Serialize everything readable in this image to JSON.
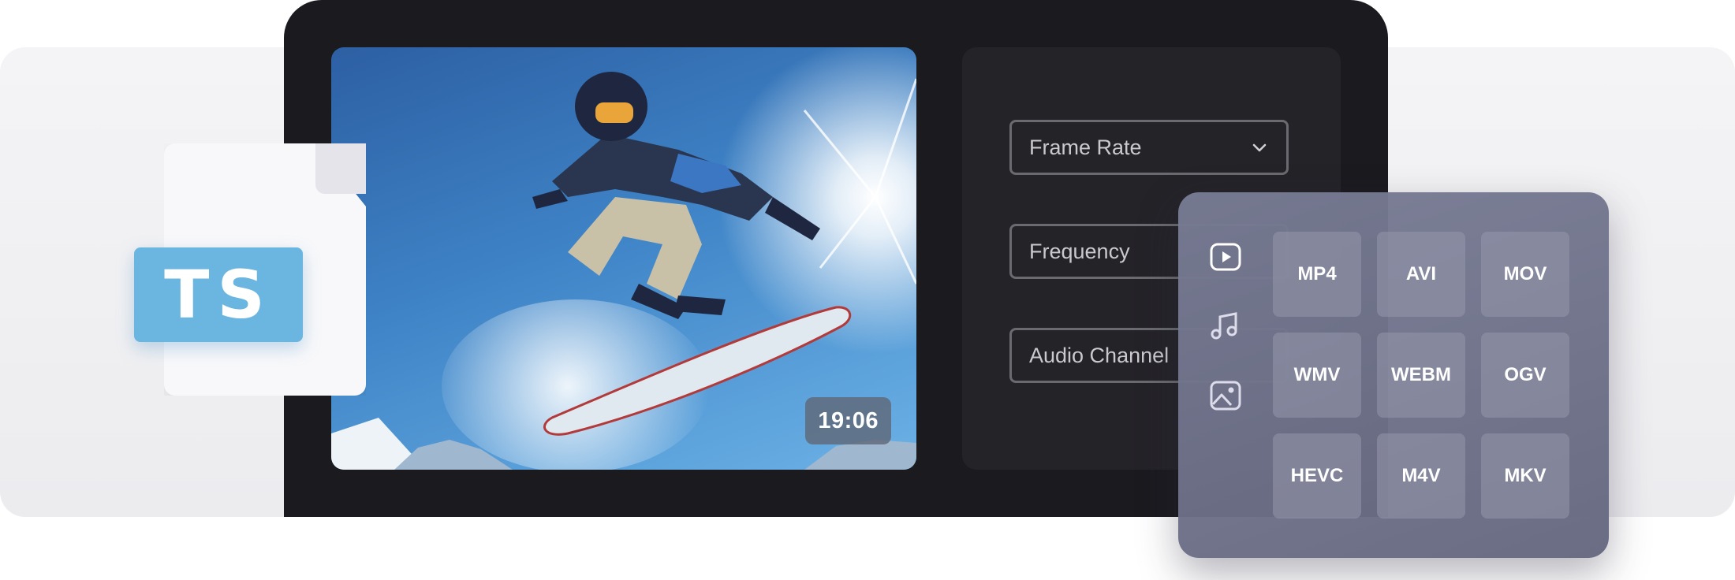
{
  "file_badge": {
    "extension": "TS"
  },
  "video": {
    "duration": "19:06",
    "thumbnail_subject": "snowboarder-jump-image"
  },
  "settings": {
    "frame_rate_label": "Frame Rate",
    "frequency_label": "Frequency",
    "audio_channel_label": "Audio Channel"
  },
  "format_picker": {
    "type_icons": [
      "video-icon",
      "music-icon",
      "image-icon"
    ],
    "formats": [
      "MP4",
      "AVI",
      "MOV",
      "WMV",
      "WEBM",
      "OGV",
      "HEVC",
      "M4V",
      "MKV"
    ]
  },
  "colors": {
    "device": "#1b1a1f",
    "file_label": "#6bb6e0",
    "format_panel": "#767893"
  }
}
